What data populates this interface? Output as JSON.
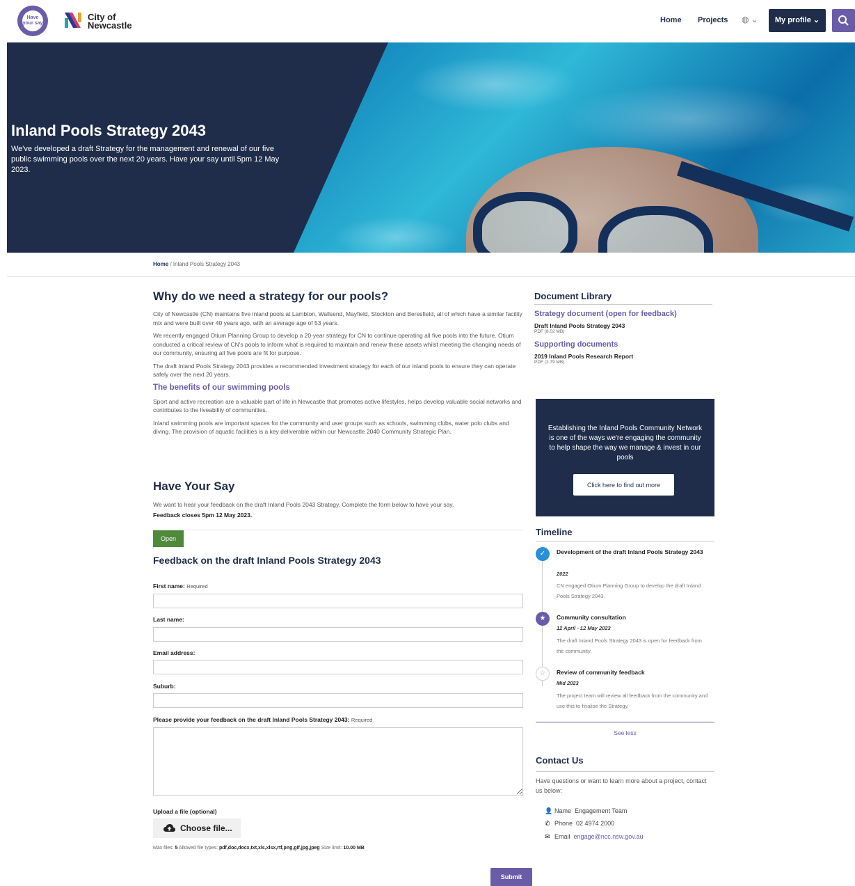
{
  "header": {
    "hys_logo_text": "Have your say",
    "brand_line1": "City of",
    "brand_line2": "Newcastle",
    "nav_home": "Home",
    "nav_projects": "Projects",
    "language_icon": "globe-icon",
    "profile_label": "My profile ⌄",
    "search_icon": "search-icon"
  },
  "hero": {
    "title": "Inland Pools Strategy 2043",
    "description": "We've developed a draft Strategy for the management and renewal of our five public swimming pools over the next 20 years. Have your say until 5pm 12 May 2023."
  },
  "breadcrumb": {
    "home": "Home",
    "separator": " / ",
    "current": "Inland Pools Strategy 2043"
  },
  "main": {
    "why_title": "Why do we need a strategy for our pools?",
    "why_p1": "City of Newcastle (CN) maintains five inland pools at Lambton, Wallsend, Mayfield, Stockton and Beresfield, all of which have a similar facility mix and were built over 40 years ago, with an average age of 53 years.",
    "why_p2": "We recently engaged Otium Planning Group to develop a 20-year strategy for CN to continue operating all five pools into the future. Otium conducted a critical review of CN's pools to inform what is required to maintain and renew these assets whilst meeting the changing needs of our community, ensuring all five pools are fit for purpose.",
    "why_p3": "The draft Inland Pools Strategy 2043 provides a recommended investment strategy for each of our inland pools to ensure they can operate safely over the next 20 years.",
    "benefits_title": "The benefits of our swimming pools",
    "benefits_p1": "Sport and active recreation are a valuable part of life in Newcastle that promotes active lifestyles, helps develop valuable social networks and contributes to the liveability of communities.",
    "benefits_p2": "Inland swimming pools are important spaces for the community and user groups such as schools, swimming clubs, water polo clubs and diving. The provision of aquatic facilities is a key deliverable within our Newcastle 2040 Community Strategic Plan.",
    "hys_title": "Have Your Say",
    "hys_p": "We want to hear your feedback on the draft Inland Pools 2043 Strategy. Complete the form below to have your say.",
    "hys_close": "Feedback closes 5pm 12 May 2023."
  },
  "form": {
    "status": "Open",
    "title": "Feedback on the draft Inland Pools Strategy 2043",
    "first_name_label": "First name:",
    "required": "Required",
    "last_name_label": "Last name:",
    "email_label": "Email address:",
    "suburb_label": "Suburb:",
    "feedback_label": "Please provide your feedback on the draft Inland Pools Strategy 2043:",
    "upload_label": "Upload a file (optional)",
    "choose_file": "Choose file...",
    "max_files_label": "Max files:",
    "max_files": "5",
    "types_label": "Allowed file types:",
    "types": "pdf,doc,docx,txt,xls,xlsx,rtf,png,gif,jpg,jpeg",
    "size_label": "Size limit:",
    "size": "10.00 MB",
    "submit": "Submit"
  },
  "documents": {
    "title": "Document Library",
    "group1": "Strategy document (open for feedback)",
    "doc1_name": "Draft Inland Pools Strategy 2043",
    "doc1_meta": "PDF (8.02 MB)",
    "group2": "Supporting documents",
    "doc2_name": "2019 Inland Pools Research Report",
    "doc2_meta": "PDF (2.79 MB)"
  },
  "promo": {
    "text": "Establishing the Inland Pools Community Network is one of the ways we're engaging the community to help shape the way we manage & invest in our pools",
    "button": "Click here to find out more"
  },
  "timeline": {
    "title": "Timeline",
    "items": [
      {
        "title": "Development of the draft Inland Pools Strategy 2043",
        "date": "2022",
        "desc": "CN engaged Otium Planning Group to develop the draft Inland Pools Strategy 2043.",
        "state": "complete",
        "icon": "check-icon"
      },
      {
        "title": "Community consultation",
        "date": "12 April - 12 May 2023",
        "desc": "The draft Inland Pools Strategy 2043 is open for feedback from the community.",
        "state": "current",
        "icon": "star-icon"
      },
      {
        "title": "Review of community feedback",
        "date": "Mid 2023",
        "desc": "The project team will review all feedback from the community and use this to finalise the Strategy.",
        "state": "upcoming",
        "icon": "star-outline-icon"
      }
    ],
    "see_less": "See less"
  },
  "contact": {
    "title": "Contact Us",
    "intro": "Have questions or want to learn more about a project, contact us below:",
    "name_label": "Name",
    "name": "Engagement Team",
    "phone_label": "Phone",
    "phone": "02 4974 2000",
    "email_label": "Email",
    "email": "engage@ncc.nsw.gov.au"
  },
  "colors": {
    "navy": "#1f2d4a",
    "purple": "#6a5ca8",
    "green": "#4e8a3a"
  }
}
